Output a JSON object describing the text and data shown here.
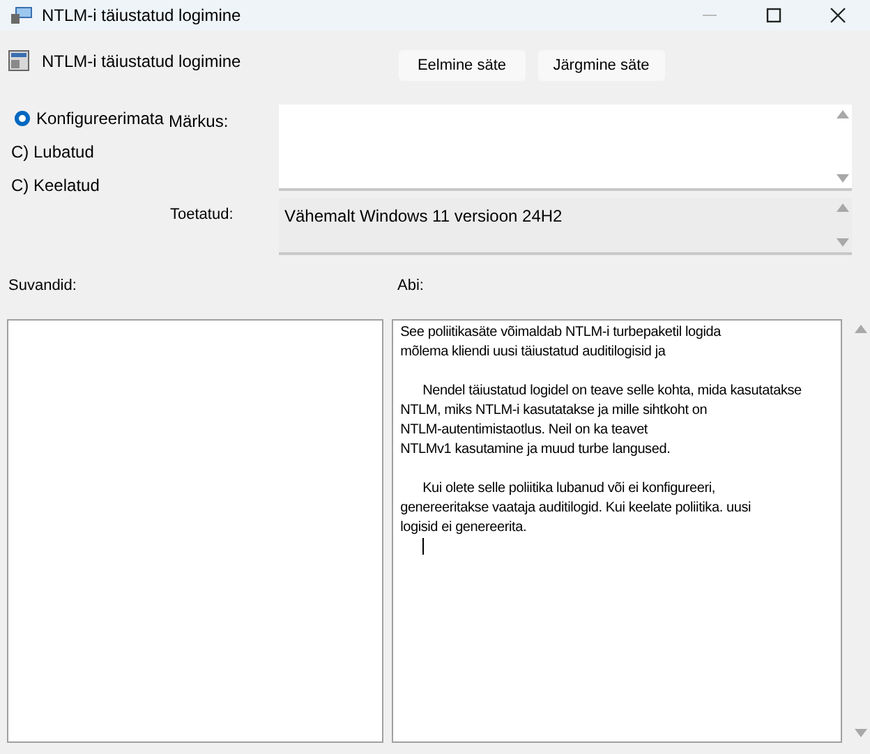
{
  "window": {
    "title": "NTLM-i täiustatud logimine"
  },
  "header": {
    "title": "NTLM-i täiustatud logimine"
  },
  "buttons": [
    "Eelmine säte",
    "Järgmine säte"
  ],
  "options": [
    {
      "label": "Konfigureerimata",
      "selected": true
    },
    {
      "label": "C) Lubatud",
      "selected": false
    },
    {
      "label": "C) Keelatud",
      "selected": false
    }
  ],
  "comment": {
    "label": "Märkus:"
  },
  "supported": {
    "label": "Toetatud:",
    "value": "Vähemalt Windows 11 versioon 24H2"
  },
  "options_panel": {
    "label": "Suvandid:"
  },
  "help": {
    "label": "Abi:",
    "paragraphs": [
      {
        "indented": false,
        "lines": [
          "See poliitikasäte võimaldab NTLM-i turbepaketil logida",
          "mõlema kliendi uusi täiustatud auditilogisid ja"
        ]
      },
      {
        "indented": true,
        "lines": [
          "Nendel täiustatud logidel on teave selle kohta, mida kasutatakse",
          "NTLM, miks NTLM-i kasutatakse ja mille sihtkoht on",
          "NTLM-autentimistaotlus. Neil on ka teavet",
          "NTLMv1 kasutamine ja muud turbe langused."
        ]
      },
      {
        "indented": true,
        "lines": [
          "Kui olete selle poliitika lubanud või ei konfigureeri,",
          "genereeritakse vaataja auditilogid. Kui keelate poliitika. uusi",
          "logisid ei genereerita."
        ]
      }
    ]
  }
}
